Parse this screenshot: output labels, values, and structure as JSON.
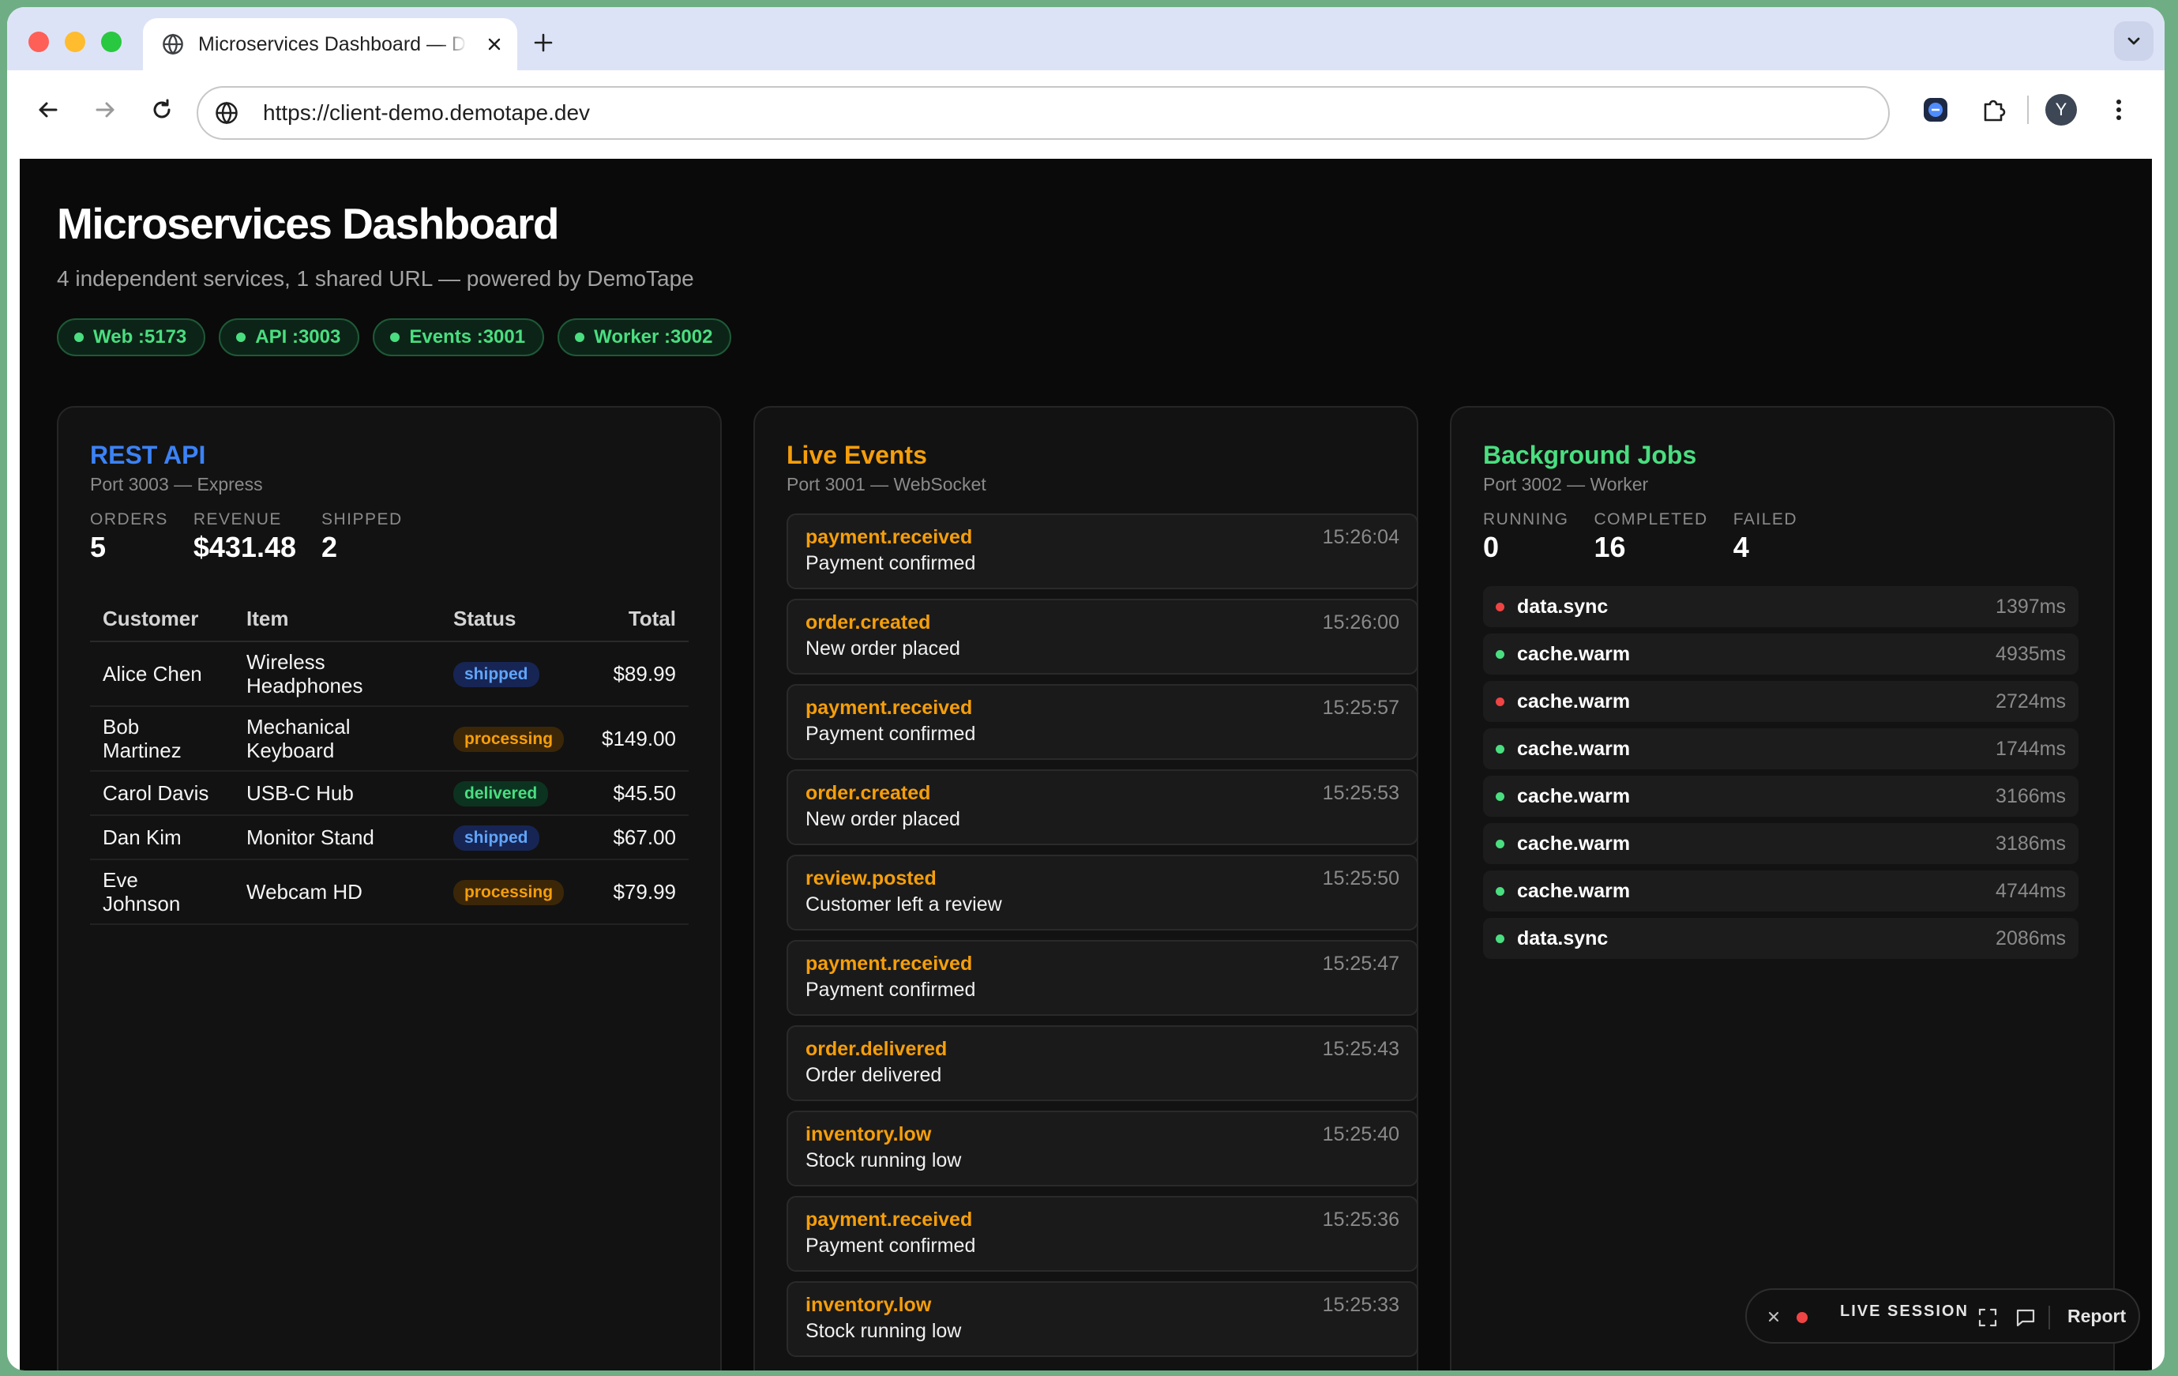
{
  "browser": {
    "tab_title": "Microservices Dashboard — DemoTape",
    "url": "https://client-demo.demotape.dev",
    "avatar_letter": "Y"
  },
  "dashboard": {
    "title": "Microservices Dashboard",
    "subtitle": "4 independent services, 1 shared URL — powered by DemoTape",
    "services": [
      {
        "label": "Web :5173"
      },
      {
        "label": "API :3003"
      },
      {
        "label": "Events :3001"
      },
      {
        "label": "Worker :3002"
      }
    ]
  },
  "rest_api": {
    "title": "REST API",
    "subtitle": "Port 3003 — Express",
    "accent": "#3b82f6",
    "stats": [
      {
        "label": "ORDERS",
        "value": "5"
      },
      {
        "label": "REVENUE",
        "value": "$431.48"
      },
      {
        "label": "SHIPPED",
        "value": "2"
      }
    ],
    "columns": [
      "Customer",
      "Item",
      "Status",
      "Total"
    ],
    "rows": [
      {
        "customer": "Alice Chen",
        "item": "Wireless Headphones",
        "status": "shipped",
        "total": "$89.99"
      },
      {
        "customer": "Bob Martinez",
        "item": "Mechanical Keyboard",
        "status": "processing",
        "total": "$149.00"
      },
      {
        "customer": "Carol Davis",
        "item": "USB-C Hub",
        "status": "delivered",
        "total": "$45.50"
      },
      {
        "customer": "Dan Kim",
        "item": "Monitor Stand",
        "status": "shipped",
        "total": "$67.00"
      },
      {
        "customer": "Eve Johnson",
        "item": "Webcam HD",
        "status": "processing",
        "total": "$79.99"
      }
    ]
  },
  "live_events": {
    "title": "Live Events",
    "subtitle": "Port 3001 — WebSocket",
    "accent": "#f59e0b",
    "events": [
      {
        "name": "payment.received",
        "desc": "Payment confirmed",
        "time": "15:26:04"
      },
      {
        "name": "order.created",
        "desc": "New order placed",
        "time": "15:26:00"
      },
      {
        "name": "payment.received",
        "desc": "Payment confirmed",
        "time": "15:25:57"
      },
      {
        "name": "order.created",
        "desc": "New order placed",
        "time": "15:25:53"
      },
      {
        "name": "review.posted",
        "desc": "Customer left a review",
        "time": "15:25:50"
      },
      {
        "name": "payment.received",
        "desc": "Payment confirmed",
        "time": "15:25:47"
      },
      {
        "name": "order.delivered",
        "desc": "Order delivered",
        "time": "15:25:43"
      },
      {
        "name": "inventory.low",
        "desc": "Stock running low",
        "time": "15:25:40"
      },
      {
        "name": "payment.received",
        "desc": "Payment confirmed",
        "time": "15:25:36"
      },
      {
        "name": "inventory.low",
        "desc": "Stock running low",
        "time": "15:25:33"
      }
    ]
  },
  "background_jobs": {
    "title": "Background Jobs",
    "subtitle": "Port 3002 — Worker",
    "accent": "#4ade80",
    "stats": [
      {
        "label": "RUNNING",
        "value": "0"
      },
      {
        "label": "COMPLETED",
        "value": "16"
      },
      {
        "label": "FAILED",
        "value": "4"
      }
    ],
    "jobs": [
      {
        "name": "data.sync",
        "duration": "1397ms",
        "state": "failed"
      },
      {
        "name": "cache.warm",
        "duration": "4935ms",
        "state": "completed"
      },
      {
        "name": "cache.warm",
        "duration": "2724ms",
        "state": "failed"
      },
      {
        "name": "cache.warm",
        "duration": "1744ms",
        "state": "completed"
      },
      {
        "name": "cache.warm",
        "duration": "3166ms",
        "state": "completed"
      },
      {
        "name": "cache.warm",
        "duration": "3186ms",
        "state": "completed"
      },
      {
        "name": "cache.warm",
        "duration": "4744ms",
        "state": "completed"
      },
      {
        "name": "data.sync",
        "duration": "2086ms",
        "state": "completed"
      }
    ],
    "state_colors": {
      "completed": "#4ade80",
      "failed": "#ef4444"
    }
  },
  "live_session": {
    "label": "LIVE SESSION",
    "report_label": "Report"
  }
}
